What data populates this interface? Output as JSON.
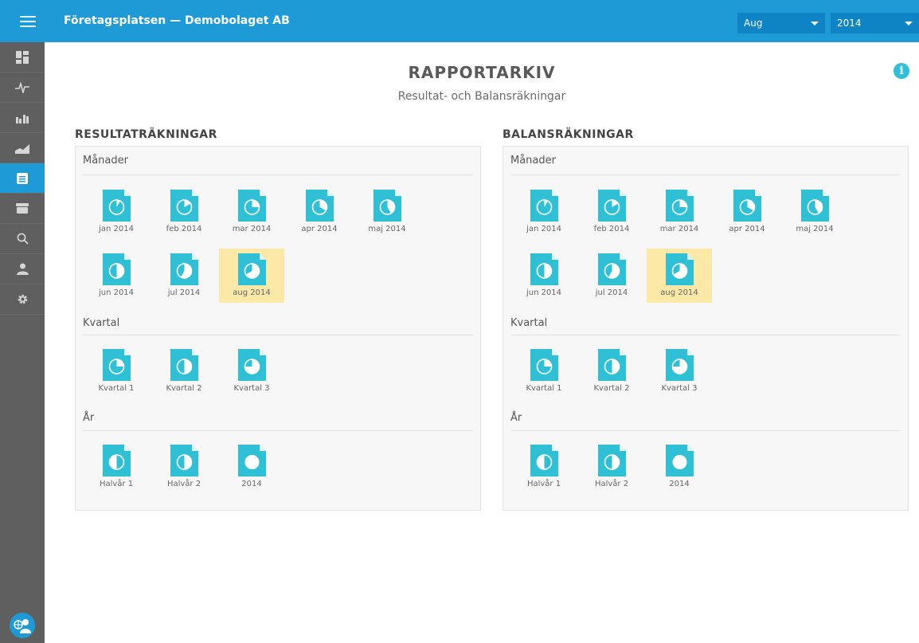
{
  "header": {
    "title": "Företagsplatsen — Demobolaget AB",
    "month_select": "Aug",
    "year_select": "2014"
  },
  "sidebar": {
    "items": [
      {
        "icon": "dashboard-icon"
      },
      {
        "icon": "pulse-icon"
      },
      {
        "icon": "bar-chart-icon"
      },
      {
        "icon": "area-chart-icon"
      },
      {
        "icon": "report-list-icon",
        "active": true
      },
      {
        "icon": "inbox-icon"
      },
      {
        "icon": "search-icon"
      },
      {
        "icon": "user-icon"
      },
      {
        "icon": "gear-icon"
      }
    ],
    "footer_icon": "support-avatar-icon"
  },
  "page": {
    "title": "RAPPORTARKIV",
    "subtitle": "Resultat- och Balansräkningar"
  },
  "sections": [
    {
      "title": "RESULTATRÄKNINGAR",
      "groups": [
        {
          "title": "Månader",
          "items": [
            "jan 2014",
            "feb 2014",
            "mar 2014",
            "apr 2014",
            "maj 2014",
            "jun 2014",
            "jul 2014",
            "aug 2014"
          ]
        },
        {
          "title": "Kvartal",
          "items": [
            "Kvartal 1",
            "Kvartal 2",
            "Kvartal 3"
          ]
        },
        {
          "title": "År",
          "items": [
            "Halvår 1",
            "Halvår 2",
            "2014"
          ]
        }
      ],
      "selected": "aug 2014"
    },
    {
      "title": "BALANSRÄKNINGAR",
      "groups": [
        {
          "title": "Månader",
          "items": [
            "jan 2014",
            "feb 2014",
            "mar 2014",
            "apr 2014",
            "maj 2014",
            "jun 2014",
            "jul 2014",
            "aug 2014"
          ]
        },
        {
          "title": "Kvartal",
          "items": [
            "Kvartal 1",
            "Kvartal 2",
            "Kvartal 3"
          ]
        },
        {
          "title": "År",
          "items": [
            "Halvår 1",
            "Halvår 2",
            "2014"
          ]
        }
      ],
      "selected": "aug 2014"
    }
  ],
  "colors": {
    "topbar": "#1e9bd7",
    "sidebar": "#5f5f5f",
    "doc_icon": "#2fc0d6",
    "selected_bg": "#fde9a7"
  }
}
